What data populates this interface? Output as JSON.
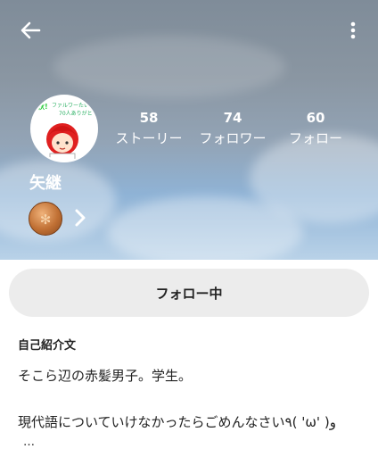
{
  "header": {
    "back_icon": "arrow-left-icon",
    "more_icon": "more-vertical-icon"
  },
  "avatar": {
    "caption": "秋!ファルワーたい70人ありがとう!"
  },
  "stats": [
    {
      "count": "58",
      "label": "ストーリー"
    },
    {
      "count": "74",
      "label": "フォロワー"
    },
    {
      "count": "60",
      "label": "フォロー"
    }
  ],
  "profile": {
    "username": "矢継",
    "badge_icon": "bronze-medal-icon"
  },
  "follow_button": {
    "label": "フォロー中"
  },
  "bio": {
    "title": "自己紹介文",
    "lines": [
      "そこら辺の赤髪男子。学生。",
      "",
      "現代語についていけなかったらごめんなさい٩( 'ω' )و",
      "…"
    ]
  },
  "colors": {
    "follow_button_bg": "#ececec",
    "text": "#222222"
  }
}
